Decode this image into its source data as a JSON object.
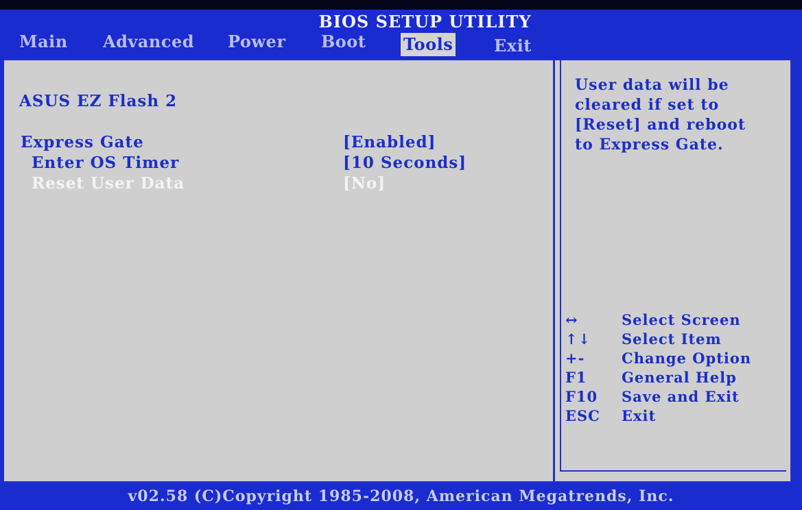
{
  "title": "BIOS SETUP UTILITY",
  "menu": {
    "items": [
      {
        "label": "Main"
      },
      {
        "label": "Advanced"
      },
      {
        "label": "Power"
      },
      {
        "label": "Boot"
      },
      {
        "label": "Tools"
      },
      {
        "label": "Exit"
      }
    ],
    "active": "Tools"
  },
  "main": {
    "rows": [
      {
        "label": "ASUS EZ Flash 2",
        "value": ""
      },
      {
        "label": "Express Gate",
        "value": "[Enabled]"
      },
      {
        "label": "Enter OS Timer",
        "value": "[10 Seconds]"
      },
      {
        "label": "Reset User Data",
        "value": "[No]"
      }
    ],
    "selected": "Reset User Data"
  },
  "help": {
    "lines": [
      "User data will be",
      "cleared if set to",
      "[Reset] and reboot",
      "to Express Gate."
    ]
  },
  "keys": [
    {
      "key": "↔",
      "desc": "Select Screen"
    },
    {
      "key": "↑↓",
      "desc": "Select Item"
    },
    {
      "key": "+-",
      "desc": "Change Option"
    },
    {
      "key": "F1",
      "desc": "General Help"
    },
    {
      "key": "F10",
      "desc": "Save and Exit"
    },
    {
      "key": "ESC",
      "desc": "Exit"
    }
  ],
  "footer": "v02.58 (C)Copyright 1985-2008, American Megatrends, Inc.",
  "colors": {
    "background": "#1a2bd0",
    "panel": "#cfcfcf",
    "text": "#1c2ec8",
    "highlight_text": "#f4f4f4"
  }
}
